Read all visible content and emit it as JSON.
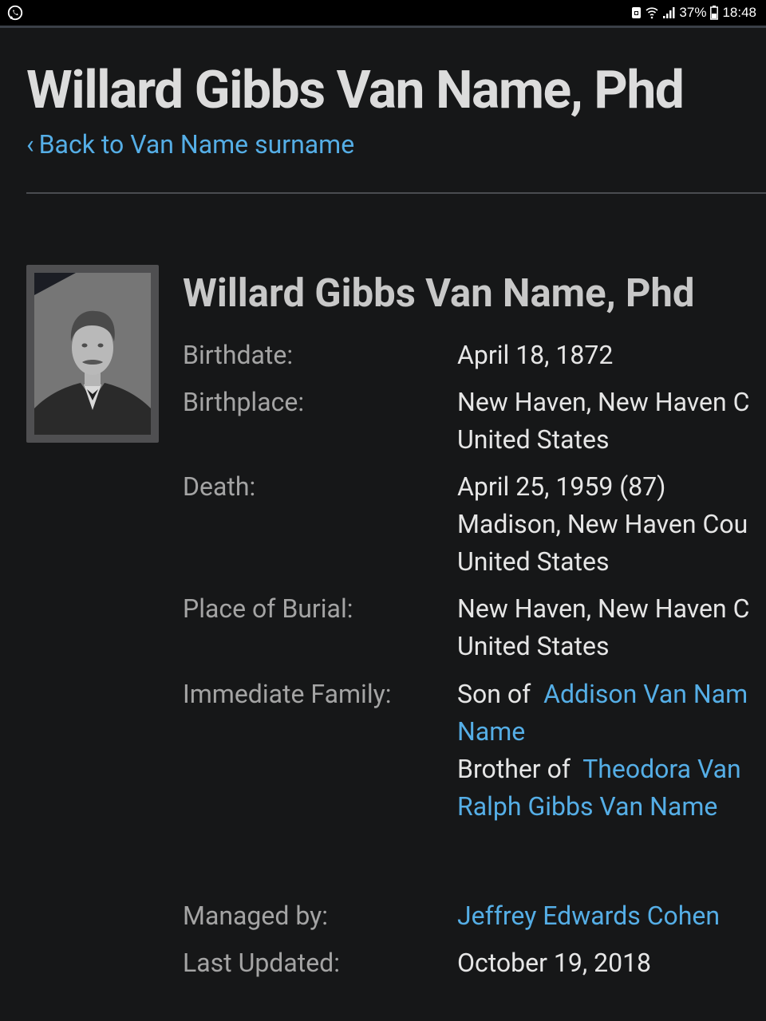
{
  "status_bar": {
    "battery_percent": "37%",
    "time": "18:48"
  },
  "page": {
    "title": "Willard Gibbs Van Name, Phd",
    "back_link": "Back to Van Name surname"
  },
  "profile": {
    "name": "Willard Gibbs Van Name, Phd",
    "details": {
      "birthdate": {
        "label": "Birthdate:",
        "value": "April 18, 1872"
      },
      "birthplace": {
        "label": "Birthplace:",
        "line1": "New Haven, New Haven C",
        "line2": "United States"
      },
      "death": {
        "label": "Death:",
        "line1": "April 25, 1959 (87)",
        "line2": "Madison, New Haven Cou",
        "line3": "United States"
      },
      "burial": {
        "label": "Place of Burial:",
        "line1": "New Haven, New Haven C",
        "line2": "United States"
      },
      "family": {
        "label": "Immediate Family:",
        "son_of_prefix": "Son of",
        "son_of_link": "Addison Van Nam",
        "son_of_link_cont": "Name",
        "brother_of_prefix": "Brother of",
        "brother_of_link1": "Theodora Van",
        "brother_of_link2": "Ralph Gibbs Van Name"
      },
      "managed_by": {
        "label": "Managed by:",
        "value": "Jeffrey Edwards Cohen"
      },
      "last_updated": {
        "label": "Last Updated:",
        "value": "October 19, 2018"
      }
    }
  },
  "colors": {
    "background": "#161718",
    "link": "#55aee6",
    "label": "#a4a4a4",
    "value": "#e6e6e6"
  }
}
